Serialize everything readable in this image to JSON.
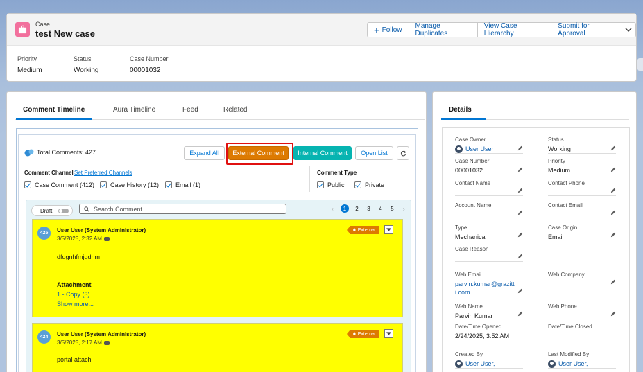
{
  "header": {
    "object_name": "Case",
    "record_title": "test New case",
    "follow_label": "Follow",
    "buttons": [
      "Manage Duplicates",
      "View Case Hierarchy",
      "Submit for Approval"
    ],
    "fields": [
      {
        "label": "Priority",
        "value": "Medium"
      },
      {
        "label": "Status",
        "value": "Working"
      },
      {
        "label": "Case Number",
        "value": "00001032"
      }
    ]
  },
  "tabs": [
    "Comment Timeline",
    "Aura Timeline",
    "Feed",
    "Related"
  ],
  "timeline": {
    "total_label": "Total Comments: 427",
    "expand_all": "Expand All",
    "external_comment": "External Comment",
    "internal_comment": "Internal Comment",
    "open_list": "Open List",
    "channel_label": "Comment Channel",
    "preferred_link": "Set Preferred Channels",
    "channels": [
      "Case Comment (412)",
      "Case History (12)",
      "Email (1)"
    ],
    "type_label": "Comment Type",
    "types": [
      "Public",
      "Private"
    ],
    "draft_label": "Draft",
    "search_placeholder": "Search Comment",
    "pages": [
      "1",
      "2",
      "3",
      "4",
      "5"
    ],
    "comments": [
      {
        "number": "425",
        "author": "User User (System Administrator)",
        "date": "3/5/2025, 2:32 AM",
        "badge": "External",
        "body": "dfdgnhfmjgdhm",
        "attachment_label": "Attachment",
        "attachment": "1 - Copy (3)",
        "show_more": "Show more..."
      },
      {
        "number": "424",
        "author": "User User (System Administrator)",
        "date": "3/5/2025, 2:17 AM",
        "badge": "External",
        "body": "portal attach"
      }
    ]
  },
  "details": {
    "tab": "Details",
    "fields": [
      {
        "label": "Case Owner",
        "value": "User User"
      },
      {
        "label": "Status",
        "value": "Working"
      },
      {
        "label": "Case Number",
        "value": "00001032"
      },
      {
        "label": "Priority",
        "value": "Medium"
      },
      {
        "label": "Contact Name",
        "value": ""
      },
      {
        "label": "Contact Phone",
        "value": ""
      },
      {
        "label": "Account Name",
        "value": ""
      },
      {
        "label": "Contact Email",
        "value": ""
      },
      {
        "label": "Type",
        "value": "Mechanical"
      },
      {
        "label": "Case Origin",
        "value": "Email"
      },
      {
        "label": "Case Reason",
        "value": ""
      },
      {
        "label": "Web Email",
        "value": "parvin.kumar@grazitti.com"
      },
      {
        "label": "Web Company",
        "value": ""
      },
      {
        "label": "Web Name",
        "value": "Parvin Kumar"
      },
      {
        "label": "Web Phone",
        "value": ""
      },
      {
        "label": "Date/Time Opened",
        "value": "2/24/2025, 3:52 AM"
      },
      {
        "label": "Date/Time Closed",
        "value": ""
      },
      {
        "label": "Created By",
        "value": "User User,"
      },
      {
        "label": "Last Modified By",
        "value": "User User,"
      }
    ]
  }
}
